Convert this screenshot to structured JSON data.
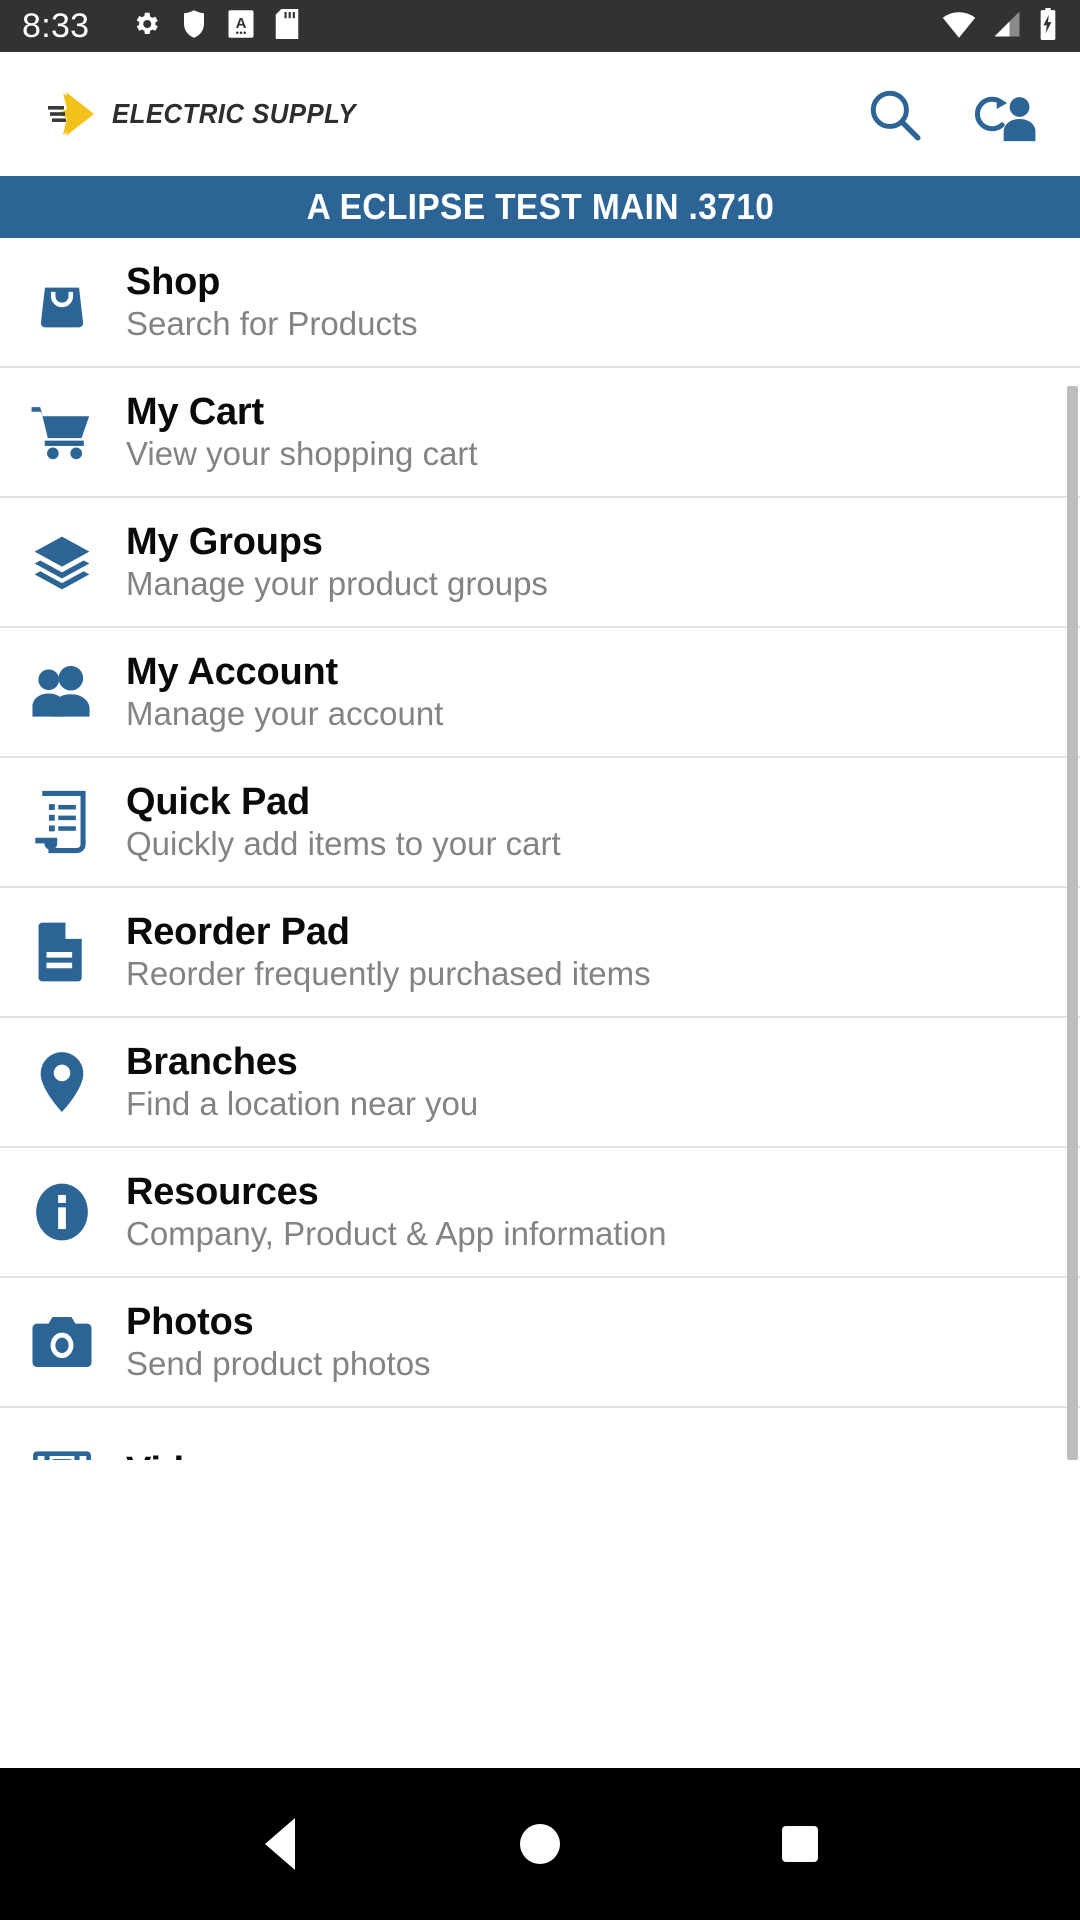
{
  "status_bar": {
    "time": "8:33",
    "left_icons": [
      "gear-icon",
      "shield-icon",
      "app-a-icon",
      "sd-card-icon"
    ],
    "right_icons": [
      "wifi-icon",
      "cellular-signal-icon",
      "battery-charging-icon"
    ],
    "background": "#323232"
  },
  "app_bar": {
    "logo_text": "ELECTRIC SUPPLY",
    "logo_mark": "yellow-arrow-icon",
    "accent_yellow": "#F5C518",
    "actions": [
      {
        "name": "search-icon",
        "label": "Search"
      },
      {
        "name": "switch-account-icon",
        "label": "Switch Account"
      }
    ]
  },
  "account_banner": {
    "text": "A ECLIPSE TEST MAIN .3710",
    "background": "#2C6595",
    "text_color": "#FFFFFF"
  },
  "menu": {
    "accent": "#2C6595",
    "items": [
      {
        "title": "Shop",
        "subtitle": "Search for Products",
        "icon": "shopping-bag-icon"
      },
      {
        "title": "My Cart",
        "subtitle": "View your shopping cart",
        "icon": "shopping-cart-icon"
      },
      {
        "title": "My Groups",
        "subtitle": "Manage your product groups",
        "icon": "layers-icon"
      },
      {
        "title": "My Account",
        "subtitle": "Manage your account",
        "icon": "people-icon"
      },
      {
        "title": "Quick Pad",
        "subtitle": "Quickly add items to your cart",
        "icon": "list-receipt-icon"
      },
      {
        "title": "Reorder Pad",
        "subtitle": "Reorder frequently purchased items",
        "icon": "document-icon"
      },
      {
        "title": "Branches",
        "subtitle": "Find a location near you",
        "icon": "map-pin-icon"
      },
      {
        "title": "Resources",
        "subtitle": "Company, Product & App information",
        "icon": "info-circle-icon"
      },
      {
        "title": "Photos",
        "subtitle": "Send product photos",
        "icon": "camera-icon"
      },
      {
        "title": "Videos",
        "subtitle": "",
        "icon": "film-strip-icon"
      }
    ]
  },
  "nav_bar": {
    "buttons": [
      {
        "name": "nav-back-button",
        "label": "Back"
      },
      {
        "name": "nav-home-button",
        "label": "Home"
      },
      {
        "name": "nav-recents-button",
        "label": "Recents"
      }
    ],
    "background": "#000000"
  }
}
